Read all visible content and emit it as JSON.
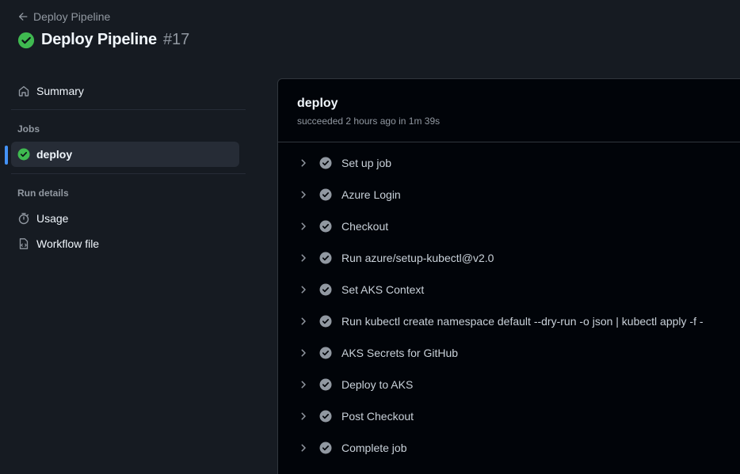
{
  "header": {
    "back_label": "Deploy Pipeline",
    "run_title": "Deploy Pipeline",
    "run_number": "#17"
  },
  "sidebar": {
    "summary_label": "Summary",
    "jobs_section": "Jobs",
    "jobs": [
      {
        "label": "deploy",
        "status": "success"
      }
    ],
    "run_details_section": "Run details",
    "usage_label": "Usage",
    "workflow_file_label": "Workflow file"
  },
  "job": {
    "name": "deploy",
    "meta": "succeeded 2 hours ago in 1m 39s",
    "steps": [
      {
        "label": "Set up job"
      },
      {
        "label": "Azure Login"
      },
      {
        "label": "Checkout"
      },
      {
        "label": "Run azure/setup-kubectl@v2.0"
      },
      {
        "label": "Set AKS Context"
      },
      {
        "label": "Run kubectl create namespace default --dry-run -o json | kubectl apply -f -"
      },
      {
        "label": "AKS Secrets for GitHub"
      },
      {
        "label": "Deploy to AKS"
      },
      {
        "label": "Post Checkout"
      },
      {
        "label": "Complete job"
      }
    ]
  },
  "colors": {
    "success": "#3fb950",
    "step_check": "#9198a1",
    "accent": "#4493f8"
  },
  "icons": {
    "back": "arrow-left-icon",
    "run_status": "check-circle-fill-icon",
    "summary": "home-icon",
    "usage": "stopwatch-icon",
    "workflow_file": "file-code-icon",
    "step_expand": "chevron-right-icon",
    "step_status": "check-circle-fill-icon"
  }
}
